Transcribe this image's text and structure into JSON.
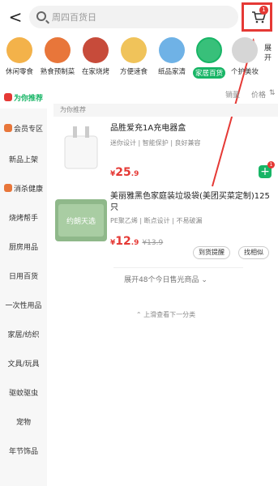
{
  "header": {
    "back_label": "<",
    "search_placeholder": "周四百货日",
    "cart_badge": "1"
  },
  "categories": [
    {
      "label": "休闲零食",
      "color": "#f3b24a"
    },
    {
      "label": "熟食预制菜",
      "color": "#e8763a"
    },
    {
      "label": "在家烧烤",
      "color": "#c74b3a"
    },
    {
      "label": "方便速食",
      "color": "#f0c35a"
    },
    {
      "label": "纸品家清",
      "color": "#6fb2e6"
    },
    {
      "label": "家居百货",
      "color": "#38c07a",
      "active": true
    },
    {
      "label": "个护美妆",
      "color": "#d6d6d6"
    }
  ],
  "expand_label": "展开",
  "sidebar": [
    {
      "label": "为你推荐",
      "active": true,
      "tag_color": "#e53935"
    },
    {
      "label": "会员专区",
      "tag_color": "#e8763a"
    },
    {
      "label": "新品上架"
    },
    {
      "label": "消杀健康",
      "tag_color": "#e8763a"
    },
    {
      "label": "烧烤帮手"
    },
    {
      "label": "厨房用品"
    },
    {
      "label": "日用百货"
    },
    {
      "label": "一次性用品"
    },
    {
      "label": "家居/纺织"
    },
    {
      "label": "文具/玩具"
    },
    {
      "label": "驱蚊驱虫"
    },
    {
      "label": "宠物"
    },
    {
      "label": "年节饰品"
    }
  ],
  "sort": {
    "sales": "销量",
    "price": "价格"
  },
  "section_title": "为你推荐",
  "products": [
    {
      "title": "品胜爱充1A充电器盒",
      "desc": "迷你设计 | 智能保护 | 良好兼容",
      "price_yen": "¥",
      "price_int": "25",
      "price_dec": ".9",
      "add_badge": "1"
    },
    {
      "title": "美丽雅黑色家庭装垃圾袋(美团买菜定制)125只",
      "desc": "PE聚乙烯 | 断点设计 | 不易破漏",
      "price_yen": "¥",
      "price_int": "12",
      "price_dec": ".9",
      "orig_price": "¥13.9",
      "img_text": "约朗天选",
      "btn_notify": "到货提醒",
      "btn_similar": "找相似"
    }
  ],
  "more_label": "展开48个今日售光商品 ⌄",
  "pull_hint": "上滑查看下一分类",
  "colors": {
    "accent": "#18b566",
    "price": "#e53935",
    "highlight": "#e53935"
  }
}
